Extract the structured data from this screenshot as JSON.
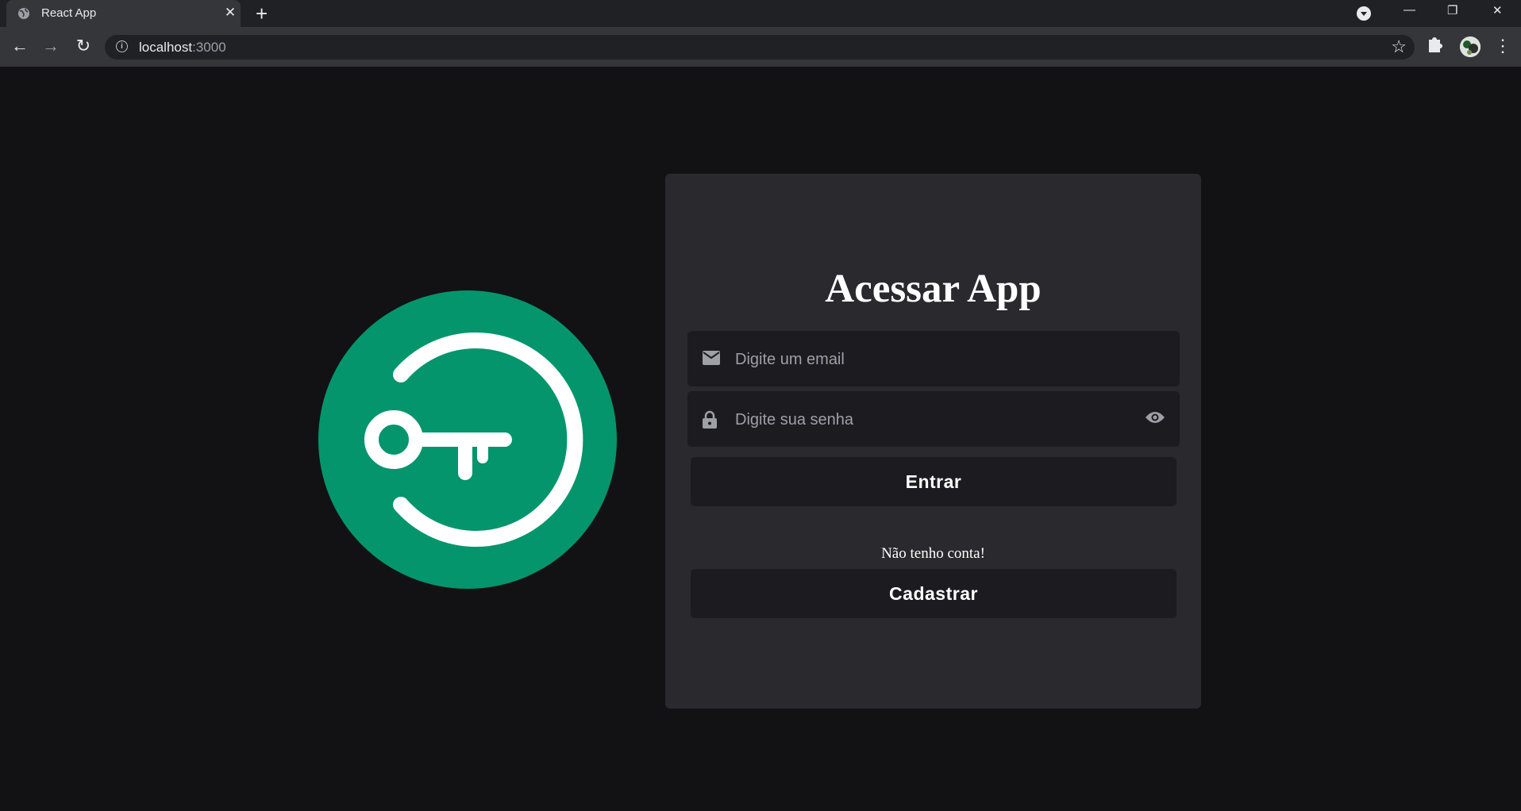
{
  "browser": {
    "tab_title": "React App",
    "tab_close": "✕",
    "new_tab": "+",
    "url_host": "localhost",
    "url_port": ":3000",
    "window_controls": {
      "minimize": "—",
      "maximize": "❐",
      "close": "✕"
    }
  },
  "login": {
    "title": "Acessar App",
    "email_placeholder": "Digite um email",
    "password_placeholder": "Digite sua senha",
    "submit_label": "Entrar",
    "no_account_text": "Não tenho conta!",
    "register_label": "Cadastrar"
  },
  "colors": {
    "page_background": "#121214",
    "card_background": "#29292e",
    "input_background": "#1c1c20",
    "logo_green": "#04956c",
    "text_white": "#ffffff"
  },
  "icons": [
    "globe-icon",
    "mail-icon",
    "lock-icon",
    "eye-icon",
    "star-icon",
    "puzzle-icon",
    "key-logo"
  ]
}
